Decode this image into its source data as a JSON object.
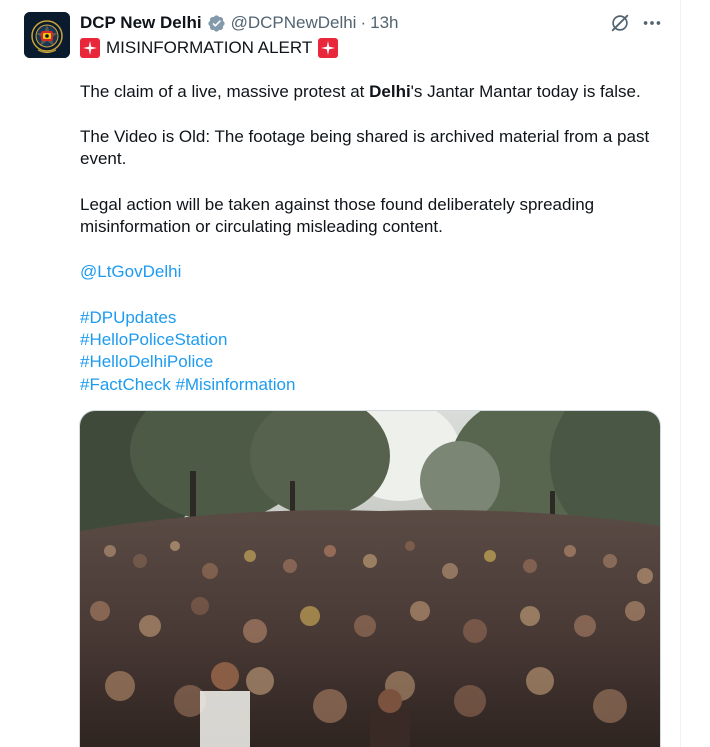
{
  "author": {
    "display_name": "DCP New Delhi",
    "handle": "@DCPNewDelhi",
    "separator": "·",
    "time": "13h",
    "avatar_icon": "delhi-police-emblem-icon",
    "verified_icon": "verified-badge-icon"
  },
  "header_icons": {
    "grok": "grok-icon",
    "more": "more-options-icon"
  },
  "tweet": {
    "alert_title": "MISINFORMATION ALERT",
    "line1_before": "The claim of a live, massive protest at ",
    "line1_bold": "Delhi",
    "line1_after": "'s Jantar Mantar today is false.",
    "para2_line1": "The Video is Old: The footage being shared is archived material from a past",
    "para2_line2": "event.",
    "para3_line1": "Legal action will be taken against those found deliberately spreading",
    "para3_line2": "misinformation or circulating misleading content.",
    "mention": "@LtGovDelhi",
    "hashtags": {
      "h1": "#DPUpdates",
      "h2": "#HelloPoliceStation",
      "h3": "#HelloDelhiPolice",
      "h4": "#FactCheck",
      "h5": "#Misinformation"
    }
  },
  "media": {
    "type": "video-thumbnail",
    "subject": "crowd-photo"
  },
  "colors": {
    "text": "#0f1419",
    "secondary": "#536471",
    "link": "#1d9bf0",
    "siren": "#e8273b",
    "verified": "#829aab"
  }
}
